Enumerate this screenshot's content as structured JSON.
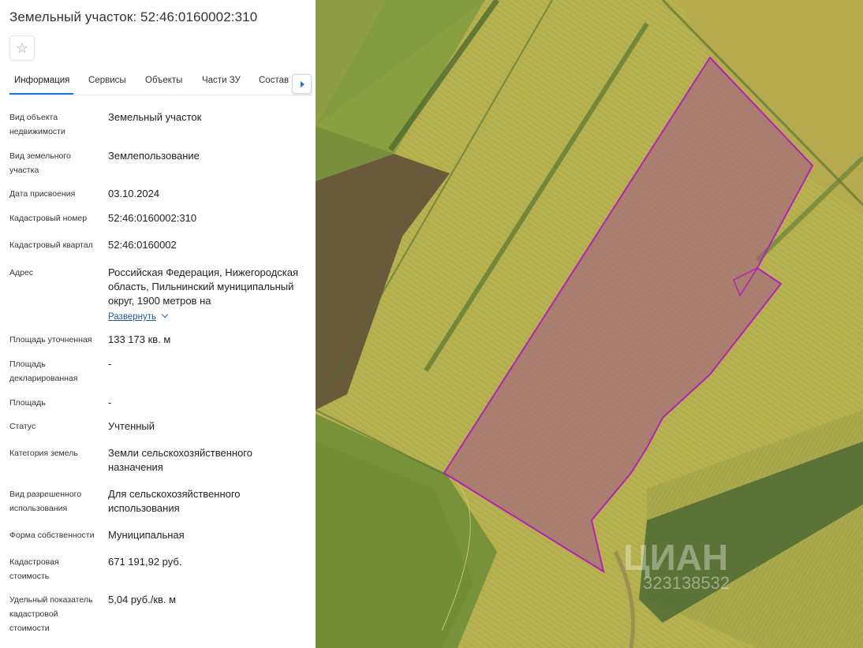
{
  "header": {
    "title": "Земельный участок: 52:46:0160002:310"
  },
  "favorite": {
    "icon": "star-icon",
    "glyph": "☆"
  },
  "tabs": [
    {
      "label": "Информация",
      "active": true
    },
    {
      "label": "Сервисы",
      "active": false
    },
    {
      "label": "Объекты",
      "active": false
    },
    {
      "label": "Части ЗУ",
      "active": false
    },
    {
      "label": "Состав",
      "active": false
    }
  ],
  "tabs_next_icon": "chevron-right-icon",
  "info": {
    "object_type": {
      "label": "Вид объекта недвижимости",
      "value": "Земельный участок"
    },
    "parcel_type": {
      "label": "Вид земельного участка",
      "value": "Землепользование"
    },
    "assigned_date": {
      "label": "Дата присвоения",
      "value": "03.10.2024"
    },
    "cadastral_number": {
      "label": "Кадастровый номер",
      "value": "52:46:0160002:310"
    },
    "cadastral_quarter": {
      "label": "Кадастровый квартал",
      "value": "52:46:0160002"
    },
    "address": {
      "label": "Адрес",
      "value": "Российская Федерация, Нижегородская область, Пильнинский муниципальный округ, 1900 метров на",
      "expand_label": "Развернуть"
    },
    "area_specified": {
      "label": "Площадь уточненная",
      "value": "133 173 кв. м"
    },
    "area_declared": {
      "label": "Площадь декларированная",
      "value": "-"
    },
    "area": {
      "label": "Площадь",
      "value": "-"
    },
    "status": {
      "label": "Статус",
      "value": "Учтенный"
    },
    "land_category": {
      "label": "Категория земель",
      "value": "Земли сельскохозяйственного назначения"
    },
    "permitted_use": {
      "label": "Вид разрешенного использования",
      "value": "Для сельскохозяйственного использования"
    },
    "ownership": {
      "label": "Форма собственности",
      "value": "Муниципальная"
    },
    "cadastral_value": {
      "label": "Кадастровая стоимость",
      "value": "671 191,92 руб."
    },
    "specific_value": {
      "label": "Удельный показатель кадастровой стоимости",
      "value": "5,04 руб./кв. м"
    }
  },
  "map": {
    "watermark_brand": "ЦИАН",
    "watermark_id": "323138532",
    "colors": {
      "parcel_border": "#b520b8",
      "parcel_fill": "#a0568a",
      "field_light": "#b5b050",
      "field_dark": "#5f6f3a"
    }
  }
}
